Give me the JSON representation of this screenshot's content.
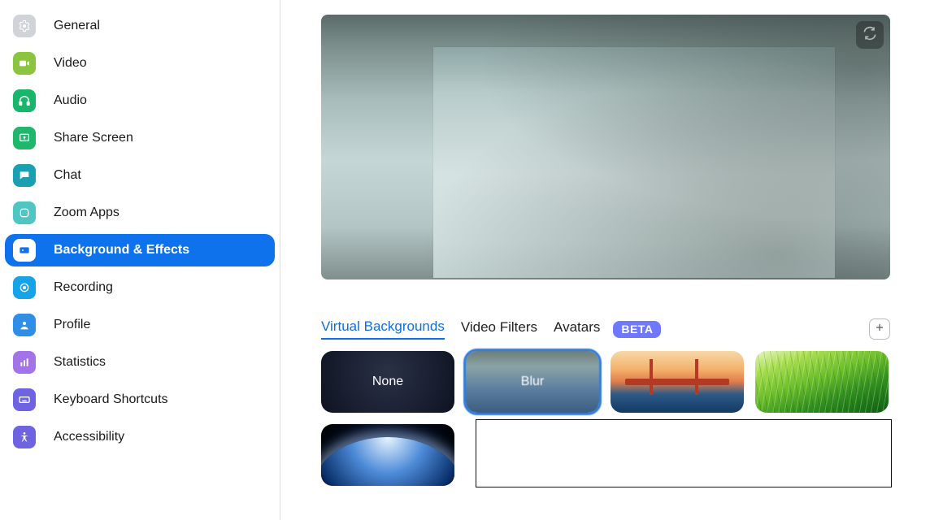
{
  "sidebar": {
    "items": [
      {
        "id": "general",
        "label": "General",
        "icon": "gear-icon"
      },
      {
        "id": "video",
        "label": "Video",
        "icon": "video-icon"
      },
      {
        "id": "audio",
        "label": "Audio",
        "icon": "headphones-icon"
      },
      {
        "id": "share",
        "label": "Share Screen",
        "icon": "share-screen-icon"
      },
      {
        "id": "chat",
        "label": "Chat",
        "icon": "chat-icon"
      },
      {
        "id": "apps",
        "label": "Zoom Apps",
        "icon": "apps-icon"
      },
      {
        "id": "bgfx",
        "label": "Background & Effects",
        "icon": "background-effects-icon",
        "active": true
      },
      {
        "id": "recording",
        "label": "Recording",
        "icon": "record-icon"
      },
      {
        "id": "profile",
        "label": "Profile",
        "icon": "profile-icon"
      },
      {
        "id": "stats",
        "label": "Statistics",
        "icon": "statistics-icon"
      },
      {
        "id": "keys",
        "label": "Keyboard Shortcuts",
        "icon": "keyboard-icon"
      },
      {
        "id": "access",
        "label": "Accessibility",
        "icon": "accessibility-icon"
      }
    ]
  },
  "tabs": {
    "items": [
      {
        "id": "vbg",
        "label": "Virtual Backgrounds",
        "active": true
      },
      {
        "id": "filters",
        "label": "Video Filters"
      },
      {
        "id": "avatars",
        "label": "Avatars",
        "badge": "BETA"
      }
    ],
    "beta_label": "BETA"
  },
  "thumbnails": {
    "none_label": "None",
    "blur_label": "Blur",
    "items": [
      {
        "id": "none",
        "kind": "none"
      },
      {
        "id": "blur",
        "kind": "blur",
        "selected": true
      },
      {
        "id": "bridge",
        "kind": "image"
      },
      {
        "id": "grass",
        "kind": "image"
      },
      {
        "id": "earth",
        "kind": "image"
      }
    ]
  },
  "colors": {
    "accent": "#0E72ED",
    "link": "#0E6FE4",
    "beta_bg": "#6f79ff"
  }
}
